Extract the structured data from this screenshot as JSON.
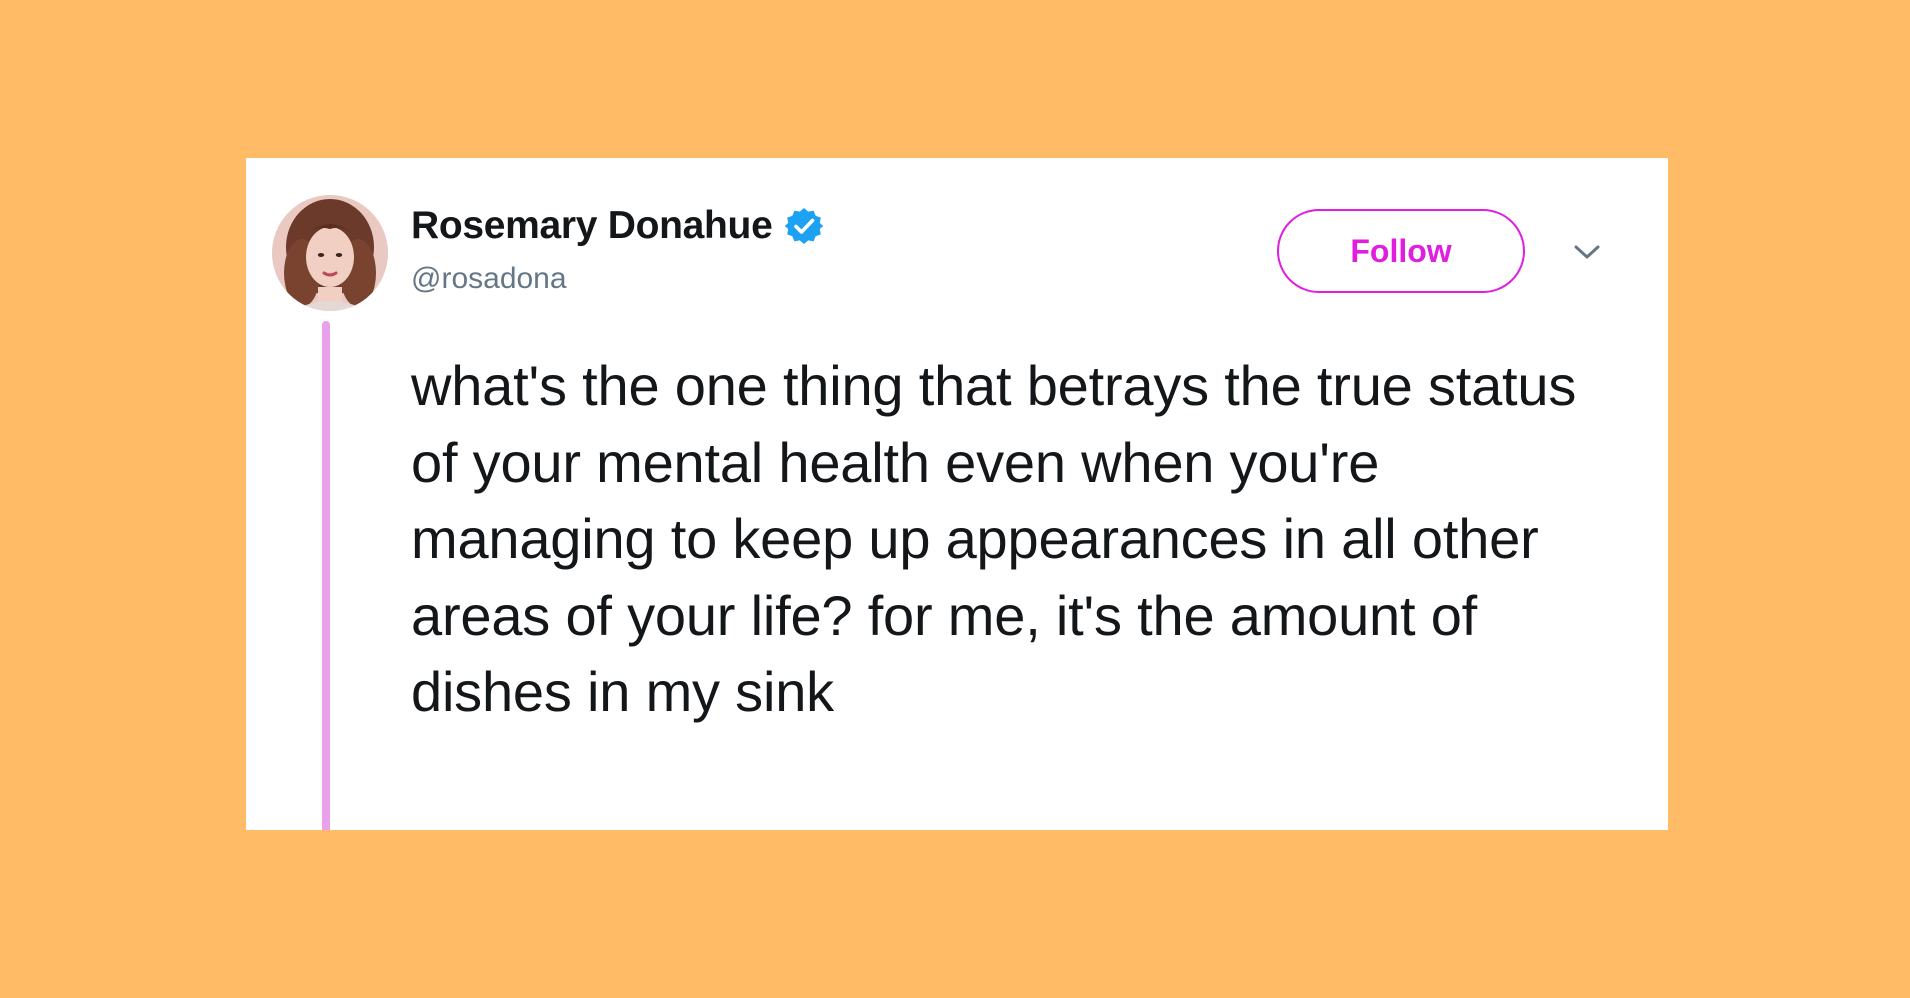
{
  "colors": {
    "background": "#ffbb66",
    "card": "#ffffff",
    "accent": "#e01ee0",
    "thread_line": "#e9a2e9",
    "verified": "#1da1f2",
    "text_primary": "#14171a",
    "text_secondary": "#657786"
  },
  "tweet": {
    "author": {
      "display_name": "Rosemary Donahue",
      "handle": "@rosadona",
      "verified": true
    },
    "follow_label": "Follow",
    "text": "what's the one thing that betrays the true status of your mental health even when you're managing to keep up appearances in all other areas of your life? for me, it's the amount of dishes in my sink"
  },
  "icons": {
    "verified": "verified-badge-icon",
    "menu": "chevron-down-icon",
    "avatar": "profile-photo"
  }
}
